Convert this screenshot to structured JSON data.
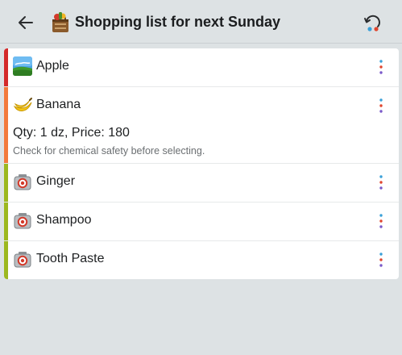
{
  "header": {
    "title": "Shopping list for next Sunday",
    "back_icon": "arrow-left-icon",
    "list_icon": "grocery-basket-icon",
    "sync_icon": "refresh-sync-icon"
  },
  "colors": {
    "red": "#d42a2a",
    "orange": "#f37a3b",
    "green": "#9cb81f",
    "background": "#dde2e4",
    "card": "#ffffff"
  },
  "items": [
    {
      "name": "Apple",
      "icon": "landscape-photo-icon",
      "priority_color": "#d42a2a"
    },
    {
      "name": "Banana",
      "icon": "banana-icon",
      "priority_color": "#f37a3b",
      "detail": "Qty: 1 dz, Price: 180",
      "note": "Check for chemical safety before selecting."
    },
    {
      "name": "Ginger",
      "icon": "camera-icon",
      "priority_color": "#9cb81f"
    },
    {
      "name": "Shampoo",
      "icon": "camera-icon",
      "priority_color": "#9cb81f"
    },
    {
      "name": "Tooth Paste",
      "icon": "camera-icon",
      "priority_color": "#9cb81f"
    }
  ]
}
